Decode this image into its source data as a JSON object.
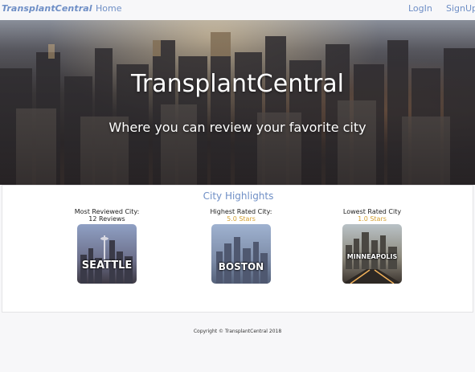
{
  "nav": {
    "brand": "TransplantCentral",
    "home": "Home",
    "login": "LogIn",
    "signup": "SignUp"
  },
  "hero": {
    "title": "TransplantCentral",
    "subtitle": "Where you can review your favorite city"
  },
  "highlights": {
    "title": "City Highlights",
    "cards": [
      {
        "label": "Most Reviewed City:",
        "value": "12 Reviews",
        "city": "SEATTLE"
      },
      {
        "label": "Highest Rated City:",
        "value": "5.0 Stars",
        "city": "BOSTON"
      },
      {
        "label": "Lowest Rated City",
        "value": "1.0 Stars",
        "city": "MINNEAPOLIS"
      }
    ]
  },
  "footer": {
    "copyright": "Copyright © TransplantCentral 2018"
  },
  "colors": {
    "accent": "#6f8fc6",
    "stars": "#d5a02f"
  }
}
